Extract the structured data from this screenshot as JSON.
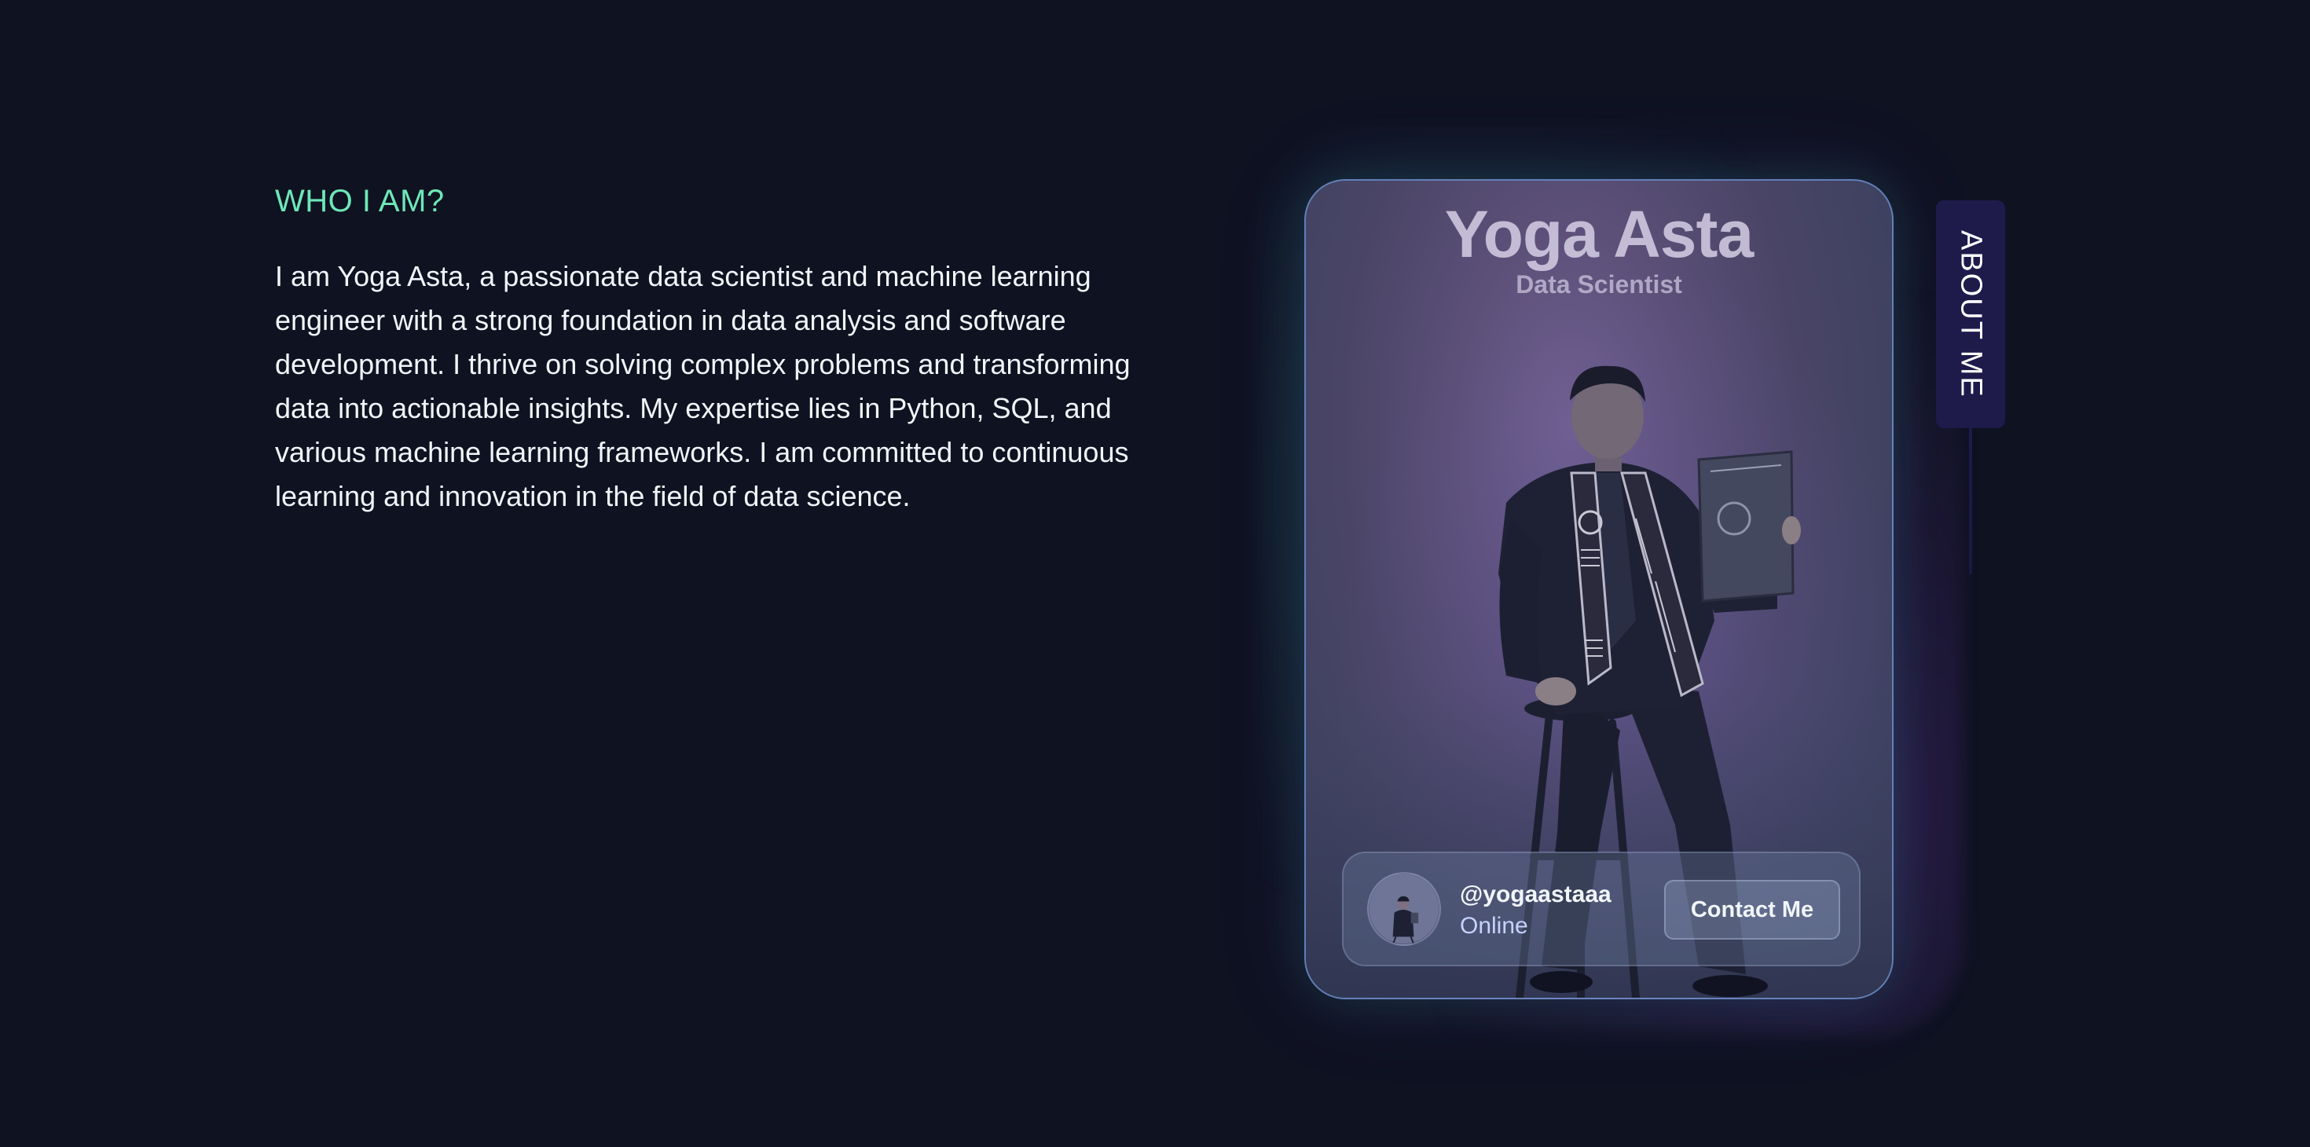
{
  "about": {
    "heading": "WHO I AM?",
    "bio": "I am Yoga Asta, a passionate data scientist and machine learning engineer with a strong foundation in data analysis and software development. I thrive on solving complex problems and transforming data into actionable insights. My expertise lies in Python, SQL, and various machine learning frameworks. I am committed to continuous learning and innovation in the field of data science."
  },
  "card": {
    "name": "Yoga Asta",
    "title": "Data Scientist",
    "photo_icon": "graduate-portrait",
    "profile": {
      "handle": "@yogaastaaa",
      "status": "Online",
      "contact_label": "Contact Me",
      "avatar_icon": "avatar-portrait"
    }
  },
  "side_tab": {
    "label": "ABOUT ME"
  },
  "colors": {
    "background": "#0f1221",
    "accent": "#6ee7b7",
    "tab": "#1e1b4b"
  }
}
